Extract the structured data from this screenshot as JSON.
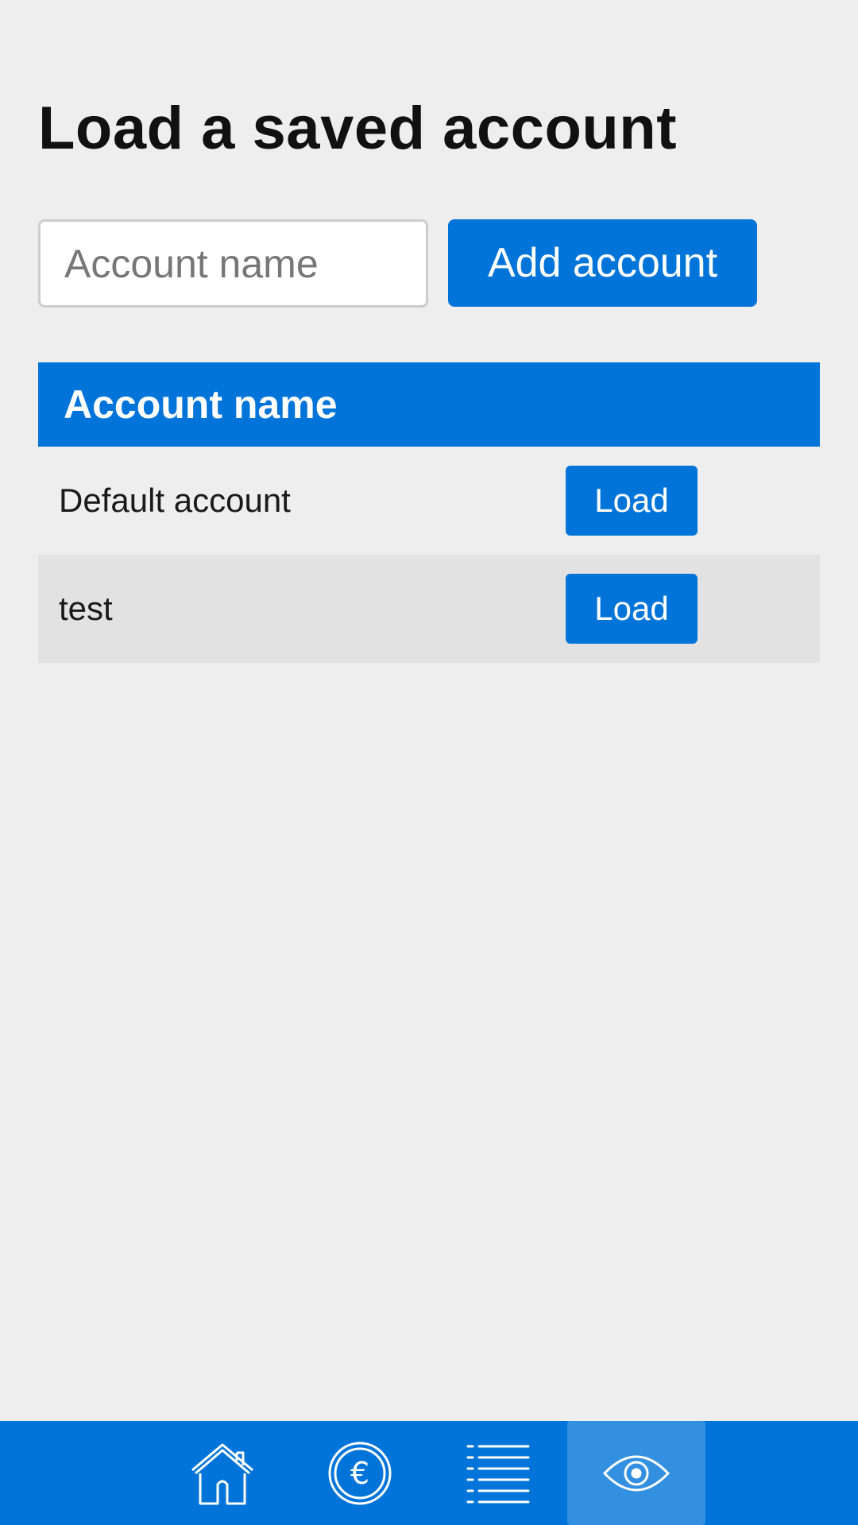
{
  "page": {
    "title": "Load a saved account"
  },
  "add_form": {
    "input_value": "",
    "input_placeholder": "Account name",
    "add_button_label": "Add account"
  },
  "table": {
    "header": "Account name",
    "rows": [
      {
        "name": "Default account",
        "action_label": "Load"
      },
      {
        "name": "test",
        "action_label": "Load"
      }
    ]
  },
  "bottom_nav": {
    "items": [
      {
        "icon": "home-icon",
        "active": false
      },
      {
        "icon": "euro-coin-icon",
        "active": false
      },
      {
        "icon": "list-icon",
        "active": false
      },
      {
        "icon": "eye-icon",
        "active": true
      }
    ]
  },
  "colors": {
    "accent": "#0074d9",
    "nav_active": "#3390e0",
    "background": "#eeeeee",
    "row_alt": "#e2e2e2"
  }
}
